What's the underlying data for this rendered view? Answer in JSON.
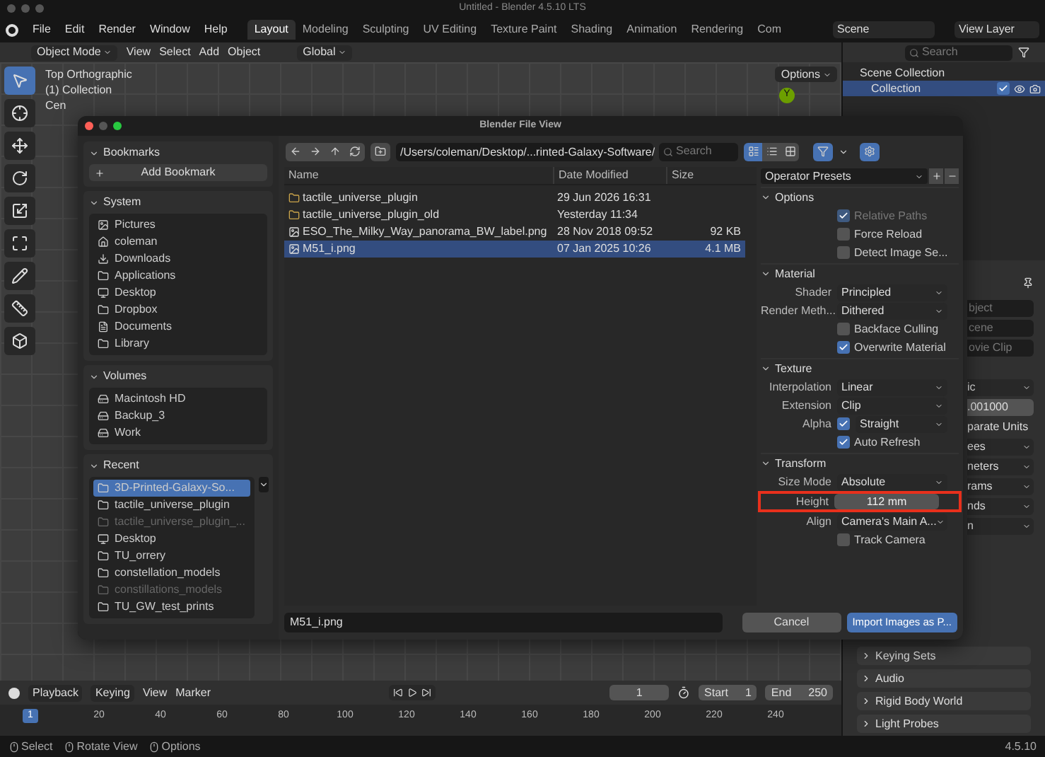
{
  "window": {
    "title": "Untitled - Blender 4.5.10 LTS"
  },
  "menu": [
    "File",
    "Edit",
    "Render",
    "Window",
    "Help"
  ],
  "workspaces": [
    {
      "label": "Layout",
      "selected": true
    },
    {
      "label": "Modeling",
      "selected": false
    },
    {
      "label": "Sculpting",
      "selected": false
    },
    {
      "label": "UV Editing",
      "selected": false
    },
    {
      "label": "Texture Paint",
      "selected": false
    },
    {
      "label": "Shading",
      "selected": false
    },
    {
      "label": "Animation",
      "selected": false
    },
    {
      "label": "Rendering",
      "selected": false
    },
    {
      "label": "Com",
      "selected": false
    }
  ],
  "scene": "Scene",
  "view_layer": "View Layer",
  "viewport": {
    "mode": "Object Mode",
    "menus": [
      "View",
      "Select",
      "Add",
      "Object"
    ],
    "orientation": "Global",
    "options": "Options",
    "overlay_text": [
      "Top Orthographic",
      "(1) Collection",
      "Cen"
    ],
    "gizmo_label": "Y",
    "tools": [
      {
        "kind": "select",
        "selected": true
      },
      {
        "kind": "cursor",
        "selected": false
      },
      {
        "kind": "move",
        "selected": false
      },
      {
        "kind": "rotate",
        "selected": false
      },
      {
        "kind": "scale",
        "selected": false
      },
      {
        "kind": "transform",
        "selected": false
      },
      {
        "kind": "annotate",
        "selected": false
      },
      {
        "kind": "measure",
        "selected": false
      },
      {
        "kind": "add_cube",
        "selected": false
      }
    ]
  },
  "outliner": {
    "search_placeholder": "Search",
    "items": [
      {
        "label": "Scene Collection",
        "children": [
          {
            "label": "Collection",
            "checked": true
          }
        ]
      }
    ]
  },
  "properties": {
    "fields": [
      {
        "placeholder": "bject"
      },
      {
        "placeholder": "cene"
      },
      {
        "placeholder": "ovie Clip"
      }
    ],
    "rows": [
      {
        "kind": "select",
        "value": "ic"
      },
      {
        "kind": "field",
        "value": ".001000"
      },
      {
        "kind": "text",
        "value": "parate Units"
      },
      {
        "kind": "select",
        "value": "ees"
      },
      {
        "kind": "select",
        "value": "neters"
      },
      {
        "kind": "select",
        "value": "rams"
      },
      {
        "kind": "select",
        "value": "nds"
      },
      {
        "kind": "select",
        "value": "n"
      }
    ],
    "panels": [
      "Keying Sets",
      "Audio",
      "Rigid Body World",
      "Light Probes"
    ]
  },
  "file_dialog": {
    "title": "Blender File View",
    "bookmarks": {
      "title": "Bookmarks",
      "add": "Add Bookmark"
    },
    "system": {
      "title": "System",
      "items": [
        {
          "kind": "image",
          "label": "Pictures"
        },
        {
          "kind": "home",
          "label": "coleman"
        },
        {
          "kind": "download",
          "label": "Downloads"
        },
        {
          "kind": "folder",
          "label": "Applications"
        },
        {
          "kind": "desktop",
          "label": "Desktop"
        },
        {
          "kind": "folder",
          "label": "Dropbox"
        },
        {
          "kind": "documents",
          "label": "Documents"
        },
        {
          "kind": "folder",
          "label": "Library"
        }
      ]
    },
    "volumes": {
      "title": "Volumes",
      "items": [
        {
          "kind": "drive",
          "label": "Macintosh HD"
        },
        {
          "kind": "drive",
          "label": "Backup_3"
        },
        {
          "kind": "drive",
          "label": "Work"
        }
      ]
    },
    "recent": {
      "title": "Recent",
      "items": [
        {
          "kind": "folder",
          "label": "3D-Printed-Galaxy-So...",
          "selected": true,
          "disabled": false
        },
        {
          "kind": "folder",
          "label": "tactile_universe_plugin",
          "selected": false,
          "disabled": false
        },
        {
          "kind": "folder",
          "label": "tactile_universe_plugin_...",
          "selected": false,
          "disabled": true
        },
        {
          "kind": "desktop",
          "label": "Desktop",
          "selected": false,
          "disabled": false
        },
        {
          "kind": "folder",
          "label": "TU_orrery",
          "selected": false,
          "disabled": false
        },
        {
          "kind": "folder",
          "label": "constellation_models",
          "selected": false,
          "disabled": false
        },
        {
          "kind": "folder",
          "label": "constillations_models",
          "selected": false,
          "disabled": true
        },
        {
          "kind": "folder",
          "label": "TU_GW_test_prints",
          "selected": false,
          "disabled": false
        }
      ]
    },
    "path": "/Users/coleman/Desktop/...rinted-Galaxy-Software/",
    "search_placeholder": "Search",
    "columns": [
      "Name",
      "Date Modified",
      "Size"
    ],
    "files": [
      {
        "kind": "folder",
        "name": "tactile_universe_plugin",
        "date": "29 Jun 2026 16:31",
        "selected": false
      },
      {
        "kind": "folder",
        "name": "tactile_universe_plugin_old",
        "date": "Yesterday 11:34",
        "selected": false
      },
      {
        "kind": "image",
        "name": "ESO_The_Milky_Way_panorama_BW_label.png",
        "date": "28 Nov 2018 09:52",
        "size": "92 KB",
        "selected": false
      },
      {
        "kind": "image",
        "name": "M51_i.png",
        "date": "07 Jan 2025 10:26",
        "size": "4.1 MB",
        "selected": true
      }
    ],
    "presets": "Operator Presets",
    "sections": [
      {
        "title": "Options",
        "rows": [
          {
            "kind": "checkbox",
            "label": "Relative Paths",
            "checked": true,
            "disabled": true
          },
          {
            "kind": "checkbox",
            "label": "Force Reload",
            "checked": false
          },
          {
            "kind": "checkbox",
            "label": "Detect Image Se...",
            "checked": false
          }
        ]
      },
      {
        "title": "Material",
        "rows": [
          {
            "kind": "select",
            "label": "Shader",
            "value": "Principled"
          },
          {
            "kind": "select",
            "label": "Render Meth...",
            "value": "Dithered"
          },
          {
            "kind": "checkbox",
            "label": "Backface Culling",
            "checked": false
          },
          {
            "kind": "checkbox",
            "label": "Overwrite Material",
            "checked": true
          }
        ]
      },
      {
        "title": "Texture",
        "rows": [
          {
            "kind": "select",
            "label": "Interpolation",
            "value": "Linear"
          },
          {
            "kind": "select",
            "label": "Extension",
            "value": "Clip"
          },
          {
            "kind": "check_select",
            "label": "Alpha",
            "checked": true,
            "value": "Straight"
          },
          {
            "kind": "checkbox",
            "label": "Auto Refresh",
            "checked": true
          }
        ]
      },
      {
        "title": "Transform",
        "rows": [
          {
            "kind": "select",
            "label": "Size Mode",
            "value": "Absolute"
          },
          {
            "kind": "number",
            "label": "Height",
            "value": "112 mm",
            "highlighted": true
          },
          {
            "kind": "select",
            "label": "Align",
            "value": "Camera's Main A..."
          },
          {
            "kind": "checkbox",
            "label": "Track Camera",
            "checked": false
          }
        ]
      }
    ],
    "filename": "M51_i.png",
    "cancel": "Cancel",
    "confirm": "Import Images as P..."
  },
  "timeline": {
    "menus": [
      "Playback",
      "Keying",
      "View",
      "Marker"
    ],
    "current_frame": "1",
    "start_label": "Start",
    "start": "1",
    "end_label": "End",
    "end": "250",
    "playhead": "1",
    "ruler": [
      "20",
      "40",
      "60",
      "80",
      "100",
      "120",
      "140",
      "160",
      "180",
      "200",
      "220",
      "240"
    ]
  },
  "status_bar": {
    "hints": [
      "Select",
      "Rotate View",
      "Options"
    ],
    "version": "4.5.10"
  }
}
